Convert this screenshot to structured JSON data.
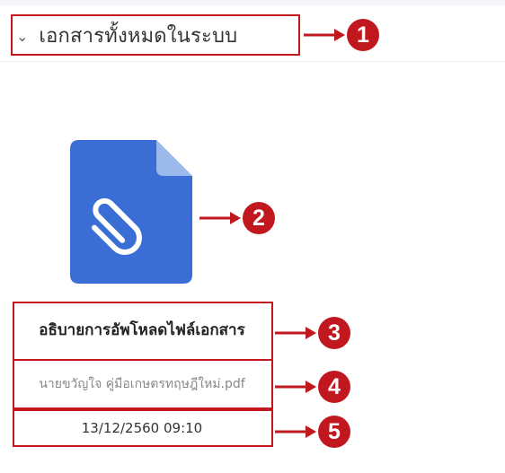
{
  "section": {
    "title": "เอกสารทั้งหมดในระบบ",
    "chevron_icon": "chevron-down"
  },
  "document": {
    "icon": "file-attachment-icon",
    "icon_color": "#3a6ed4",
    "name": "อธิบายการอัพโหลดไฟล์เอกสาร",
    "file_name": "นายขวัญใจ คู่มือเกษตรทฤษฎีใหม่.pdf",
    "timestamp": "13/12/2560 09:10"
  },
  "annotations": {
    "color": "#c0181e",
    "badges": [
      "1",
      "2",
      "3",
      "4",
      "5"
    ]
  }
}
